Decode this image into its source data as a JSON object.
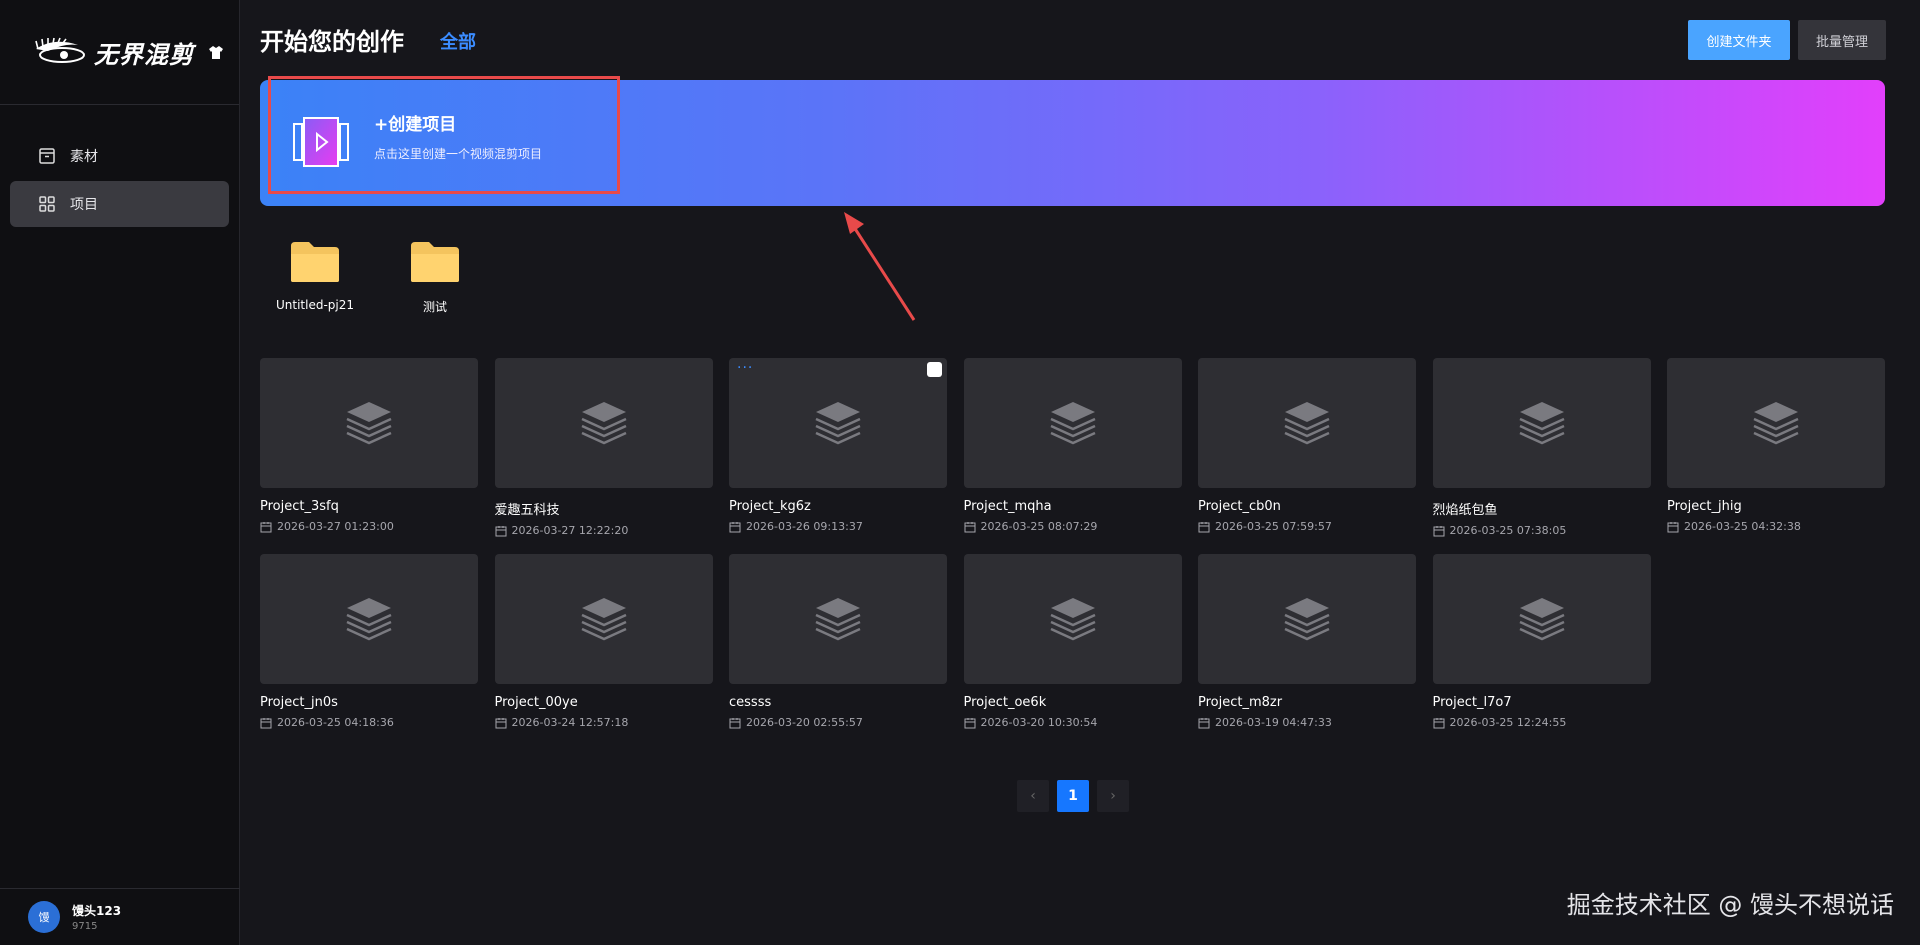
{
  "app": {
    "logo_text": "无界混剪",
    "logo_icon": "eye-logo-icon",
    "shirt_icon": "shirt-icon"
  },
  "sidebar": {
    "items": [
      {
        "label": "素材",
        "icon": "material-box-icon",
        "active": false
      },
      {
        "label": "项目",
        "icon": "grid-icon",
        "active": true
      }
    ],
    "user": {
      "name": "馒头123",
      "id": "9715",
      "avatar_text": "馒"
    }
  },
  "header": {
    "title": "开始您的创作",
    "filter": "全部",
    "create_folder_label": "创建文件夹",
    "batch_label": "批量管理"
  },
  "banner": {
    "title": "+创建项目",
    "subtitle": "点击这里创建一个视频混剪项目"
  },
  "folders": [
    {
      "name": "Untitled-pj21"
    },
    {
      "name": "测试"
    }
  ],
  "projects": [
    {
      "name": "Project_3sfq",
      "date": "2026-03-27 01:23:00"
    },
    {
      "name": "爱趣五科技",
      "date": "2026-03-27 12:22:20"
    },
    {
      "name": "Project_kg6z",
      "date": "2026-03-26 09:13:37",
      "more": "···"
    },
    {
      "name": "Project_mqha",
      "date": "2026-03-25 08:07:29"
    },
    {
      "name": "Project_cb0n",
      "date": "2026-03-25 07:59:57"
    },
    {
      "name": "烈焰纸包鱼",
      "date": "2026-03-25 07:38:05"
    },
    {
      "name": "Project_jhig",
      "date": "2026-03-25 04:32:38"
    },
    {
      "name": "Project_jn0s",
      "date": "2026-03-25 04:18:36"
    },
    {
      "name": "Project_00ye",
      "date": "2026-03-24 12:57:18"
    },
    {
      "name": "cessss",
      "date": "2026-03-20 02:55:57"
    },
    {
      "name": "Project_oe6k",
      "date": "2026-03-20 10:30:54"
    },
    {
      "name": "Project_m8zr",
      "date": "2026-03-19 04:47:33"
    },
    {
      "name": "Project_l7o7",
      "date": "2026-03-25 12:24:55"
    }
  ],
  "pagination": {
    "prev": "‹",
    "current": "1",
    "next": "›"
  },
  "watermark": "掘金技术社区 @ 馒头不想说话",
  "colors": {
    "accent": "#1677ff",
    "link": "#3b8cff",
    "highlight": "#e84a4a"
  }
}
